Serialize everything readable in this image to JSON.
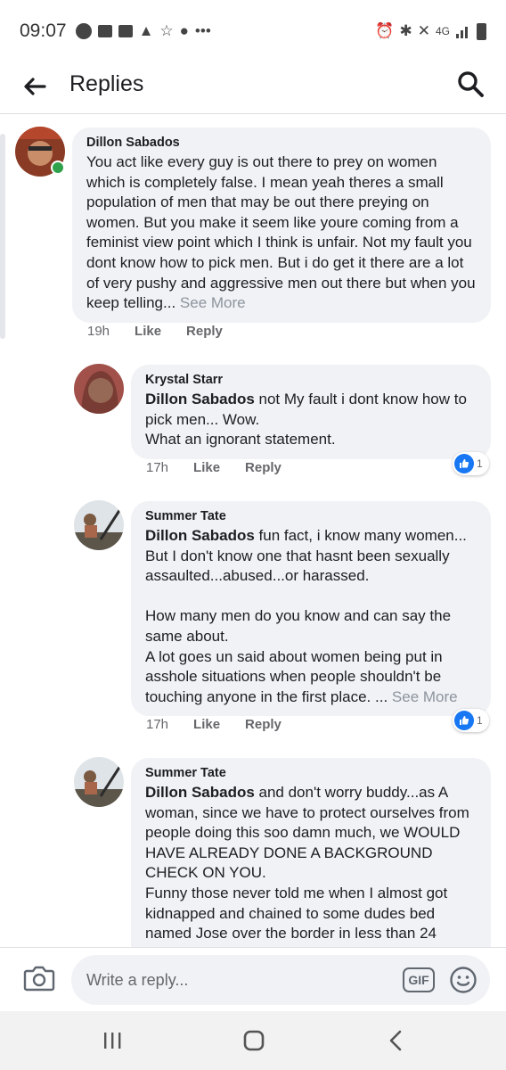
{
  "status_bar": {
    "time": "09:07",
    "ellipsis": "•••",
    "network": "4G"
  },
  "header": {
    "title": "Replies"
  },
  "comments": [
    {
      "author": "Dillon Sabados",
      "text": "You act like every guy is out there to prey on women which is completely false. I mean yeah theres a small population of men that may be out there preying on women. But you make it seem like youre coming from a feminist view point which I think is unfair. Not my fault you dont know how to pick men. But i do get it there are a lot of very pushy and aggressive men out there but when you keep telling...",
      "see_more": "See More",
      "time": "19h",
      "like": "Like",
      "reply": "Reply"
    },
    {
      "author": "Krystal Starr",
      "mention": "Dillon Sabados",
      "text": "  not My fault i dont know how to pick men... Wow.\nWhat an ignorant  statement.",
      "time": "17h",
      "like": "Like",
      "reply": "Reply",
      "reaction_count": "1"
    },
    {
      "author": "Summer Tate",
      "mention": "Dillon Sabados",
      "text": " fun fact, i know many women...\nBut I don't know one that hasnt been sexually assaulted...abused...or harassed.\n\nHow many men do you know and can say the same about.\nA lot goes un said about women being put in asshole situations when people shouldn't be touching anyone in the first place. ...",
      "see_more": "See More",
      "time": "17h",
      "like": "Like",
      "reply": "Reply",
      "reaction_count": "1"
    },
    {
      "author": "Summer Tate",
      "mention": "Dillon Sabados",
      "text": " and don't worry buddy...as A woman, since we have to protect ourselves from people doing this soo damn much, we WOULD HAVE ALREADY DONE A BACKGROUND CHECK ON YOU.\nFunny those never told me when I almost got kidnapped and chained to some dudes bed named Jose over the border in less than 24"
    }
  ],
  "composer": {
    "placeholder": "Write a reply...",
    "gif_label": "GIF"
  },
  "colors": {
    "bubble": "#f0f2f5",
    "like_blue": "#1877f2",
    "online_green": "#31a24c"
  }
}
